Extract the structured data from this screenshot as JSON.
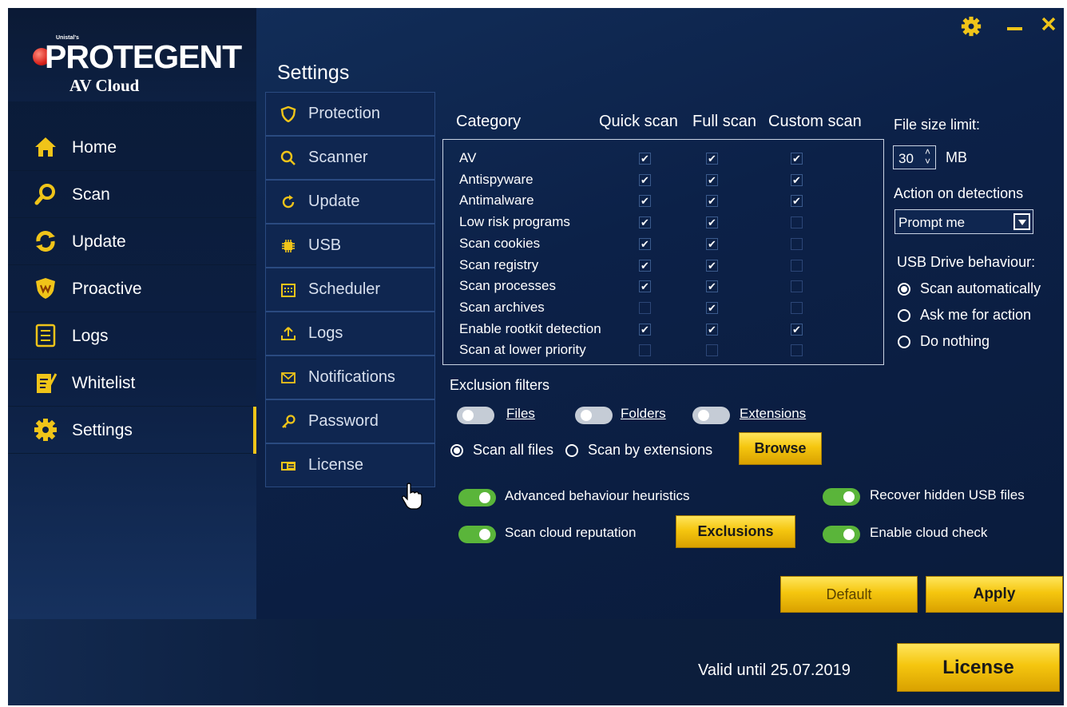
{
  "brand": {
    "maker": "Unistal's",
    "name": "PROTEGENT",
    "product": "AV Cloud"
  },
  "sidebar": {
    "items": [
      {
        "label": "Home",
        "icon": "home-icon"
      },
      {
        "label": "Scan",
        "icon": "scan-icon"
      },
      {
        "label": "Update",
        "icon": "update-icon"
      },
      {
        "label": "Proactive",
        "icon": "proactive-shield-icon"
      },
      {
        "label": "Logs",
        "icon": "logs-icon"
      },
      {
        "label": "Whitelist",
        "icon": "whitelist-icon"
      },
      {
        "label": "Settings",
        "icon": "gear-icon",
        "active": true
      }
    ]
  },
  "settings": {
    "title": "Settings",
    "subnav": [
      {
        "label": "Protection",
        "icon": "shield-icon"
      },
      {
        "label": "Scanner",
        "icon": "magnifier-icon"
      },
      {
        "label": "Update",
        "icon": "refresh-icon"
      },
      {
        "label": "USB",
        "icon": "chip-icon"
      },
      {
        "label": "Scheduler",
        "icon": "calendar-icon"
      },
      {
        "label": "Logs",
        "icon": "upload-icon"
      },
      {
        "label": "Notifications",
        "icon": "envelope-icon"
      },
      {
        "label": "Password",
        "icon": "key-icon"
      },
      {
        "label": "License",
        "icon": "license-card-icon"
      }
    ]
  },
  "scan_table": {
    "headers": {
      "category": "Category",
      "quick": "Quick scan",
      "full": "Full scan",
      "custom": "Custom scan"
    },
    "rows": [
      {
        "label": "AV",
        "quick": true,
        "full": true,
        "custom": true
      },
      {
        "label": "Antispyware",
        "quick": true,
        "full": true,
        "custom": true
      },
      {
        "label": "Antimalware",
        "quick": true,
        "full": true,
        "custom": true
      },
      {
        "label": "Low risk programs",
        "quick": true,
        "full": true,
        "custom": false
      },
      {
        "label": "Scan cookies",
        "quick": true,
        "full": true,
        "custom": false
      },
      {
        "label": "Scan registry",
        "quick": true,
        "full": true,
        "custom": false
      },
      {
        "label": "Scan processes",
        "quick": true,
        "full": true,
        "custom": false
      },
      {
        "label": "Scan archives",
        "quick": false,
        "full": true,
        "custom": false
      },
      {
        "label": "Enable rootkit detection",
        "quick": true,
        "full": true,
        "custom": true
      },
      {
        "label": "Scan at lower priority",
        "quick": false,
        "full": false,
        "custom": false
      }
    ]
  },
  "right_panel": {
    "file_size_label": "File size limit:",
    "file_size_value": "30",
    "file_size_unit": "MB",
    "action_label": "Action on detections",
    "action_value": "Prompt me",
    "usb_label": "USB Drive behaviour:",
    "usb_options": [
      {
        "label": "Scan automatically",
        "selected": true
      },
      {
        "label": "Ask me for action",
        "selected": false
      },
      {
        "label": "Do nothing",
        "selected": false
      }
    ]
  },
  "exclusions": {
    "title": "Exclusion filters",
    "toggles": [
      {
        "label": "Files",
        "on": false
      },
      {
        "label": "Folders",
        "on": false
      },
      {
        "label": "Extensions",
        "on": false
      }
    ],
    "scan_all_label": "Scan all files",
    "scan_all_selected": true,
    "scan_ext_label": "Scan by extensions",
    "browse_label": "Browse"
  },
  "features": {
    "advanced_heuristics": {
      "label": "Advanced behaviour heuristics",
      "on": true
    },
    "cloud_reputation": {
      "label": "Scan cloud reputation",
      "on": true
    },
    "recover_usb": {
      "label": "Recover hidden USB files",
      "on": true
    },
    "cloud_check": {
      "label": "Enable cloud check",
      "on": true
    },
    "exclusions_label": "Exclusions"
  },
  "actions": {
    "default_label": "Default",
    "apply_label": "Apply"
  },
  "footer": {
    "valid_until": "Valid until 25.07.2019",
    "license_label": "License"
  },
  "colors": {
    "accent": "#f0c419",
    "background": "#0c2148",
    "toggle_on": "#5ab53a"
  }
}
